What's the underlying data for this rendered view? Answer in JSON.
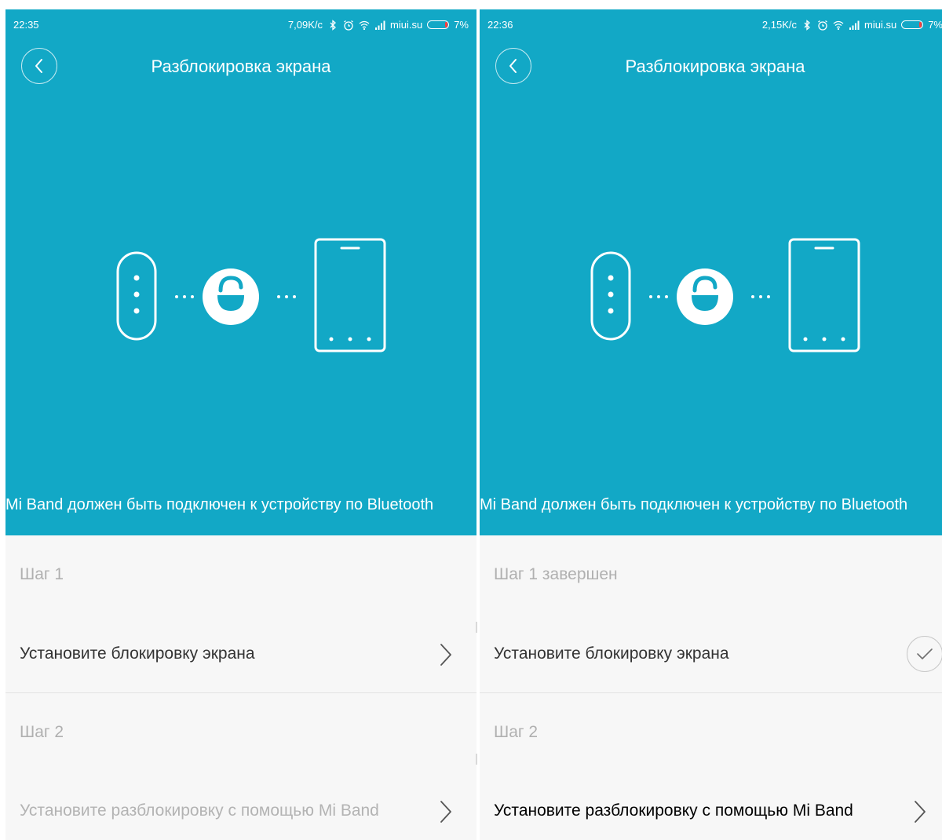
{
  "colors": {
    "hero": "#12a8c6",
    "text_white": "#ffffff",
    "list_bg": "#f7f7f7"
  },
  "screens": [
    {
      "status_time": "22:35",
      "status_speed": "7,09K/c",
      "status_carrier": "miui.su",
      "status_battery": "7%",
      "battery_level": 0.07,
      "title": "Разблокировка экрана",
      "hint": "Mi Band должен быть подключен к устройству по Bluetooth",
      "step1_label": "Шаг 1",
      "step1_action": "Установите блокировку экрана",
      "step1_done": false,
      "step2_label": "Шаг 2",
      "step2_action": "Установите разблокировку с помощью Mi Band",
      "step2_enabled": false
    },
    {
      "status_time": "22:36",
      "status_speed": "2,15K/c",
      "status_carrier": "miui.su",
      "status_battery": "7%",
      "battery_level": 0.07,
      "title": "Разблокировка экрана",
      "hint": "Mi Band должен быть подключен к устройству по Bluetooth",
      "step1_label": "Шаг 1 завершен",
      "step1_action": "Установите блокировку экрана",
      "step1_done": true,
      "step2_label": "Шаг 2",
      "step2_action": "Установите разблокировку с помощью Mi Band",
      "step2_enabled": true
    }
  ],
  "icons": [
    "back-arrow-icon",
    "bluetooth-icon",
    "alarm-icon",
    "wifi-icon",
    "signal-icon",
    "battery-icon",
    "mi-band-icon",
    "unlock-icon",
    "phone-icon",
    "chevron-right-icon",
    "checkmark-icon"
  ]
}
